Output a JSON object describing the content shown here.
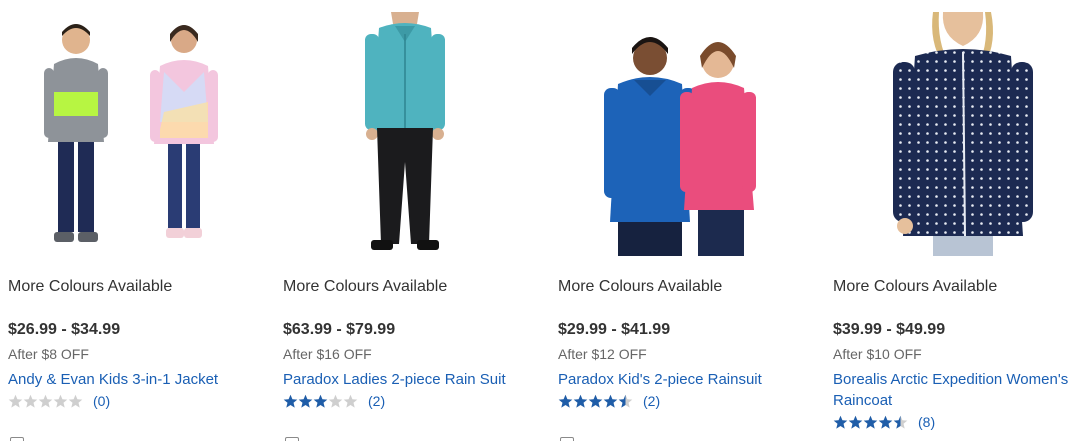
{
  "colors": {
    "link": "#1a5fb4",
    "star_filled": "#1f5da8",
    "star_empty": "#cfcfcf",
    "text": "#333333",
    "muted": "#666666"
  },
  "products": [
    {
      "availability": "More Colours Available",
      "price_range": "$26.99 - $34.99",
      "discount": "After $8 OFF",
      "name": "Andy & Evan Kids 3-in-1 Jacket",
      "rating": 0,
      "review_count": "(0)"
    },
    {
      "availability": "More Colours Available",
      "price_range": "$63.99 - $79.99",
      "discount": "After $16 OFF",
      "name": "Paradox Ladies 2-piece Rain Suit",
      "rating": 3,
      "review_count": "(2)"
    },
    {
      "availability": "More Colours Available",
      "price_range": "$29.99 - $41.99",
      "discount": "After $12 OFF",
      "name": "Paradox Kid's 2-piece Rainsuit",
      "rating": 4.5,
      "review_count": "(2)"
    },
    {
      "availability": "More Colours Available",
      "price_range": "$39.99 - $49.99",
      "discount": "After $10 OFF",
      "name": "Borealis Arctic Expedition Women's Raincoat",
      "rating": 4.5,
      "review_count": "(8)"
    }
  ]
}
